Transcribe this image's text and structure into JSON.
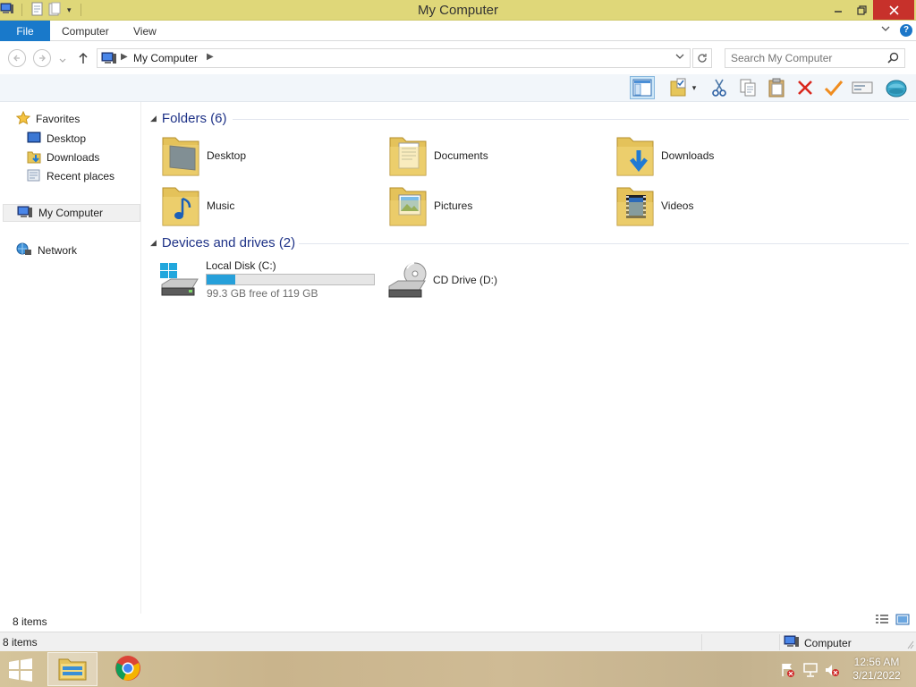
{
  "window": {
    "title": "My Computer"
  },
  "ribbon": {
    "file_tab": "File",
    "tabs": [
      "Computer",
      "View"
    ]
  },
  "address": {
    "path": "My Computer",
    "search_placeholder": "Search My Computer"
  },
  "nav": {
    "favorites": "Favorites",
    "favorites_items": [
      "Desktop",
      "Downloads",
      "Recent places"
    ],
    "my_computer": "My Computer",
    "network": "Network"
  },
  "content": {
    "folders_header": "Folders (6)",
    "folders": [
      "Desktop",
      "Documents",
      "Downloads",
      "Music",
      "Pictures",
      "Videos"
    ],
    "devices_header": "Devices and drives (2)",
    "drives": [
      {
        "label": "Local Disk (C:)",
        "free_text": "99.3 GB free of 119 GB",
        "used_fraction": 0.17
      },
      {
        "label": "CD Drive (D:)"
      }
    ]
  },
  "status": {
    "items": "8 items",
    "items2": "8 items",
    "zone": "Computer"
  },
  "taskbar": {
    "time": "12:56 AM",
    "date": "3/21/2022"
  },
  "colors": {
    "title_bar": "#dfd779",
    "file_tab": "#1979ca",
    "progress": "#26a0da",
    "close": "#c7312b",
    "group_header": "#1e3287"
  }
}
